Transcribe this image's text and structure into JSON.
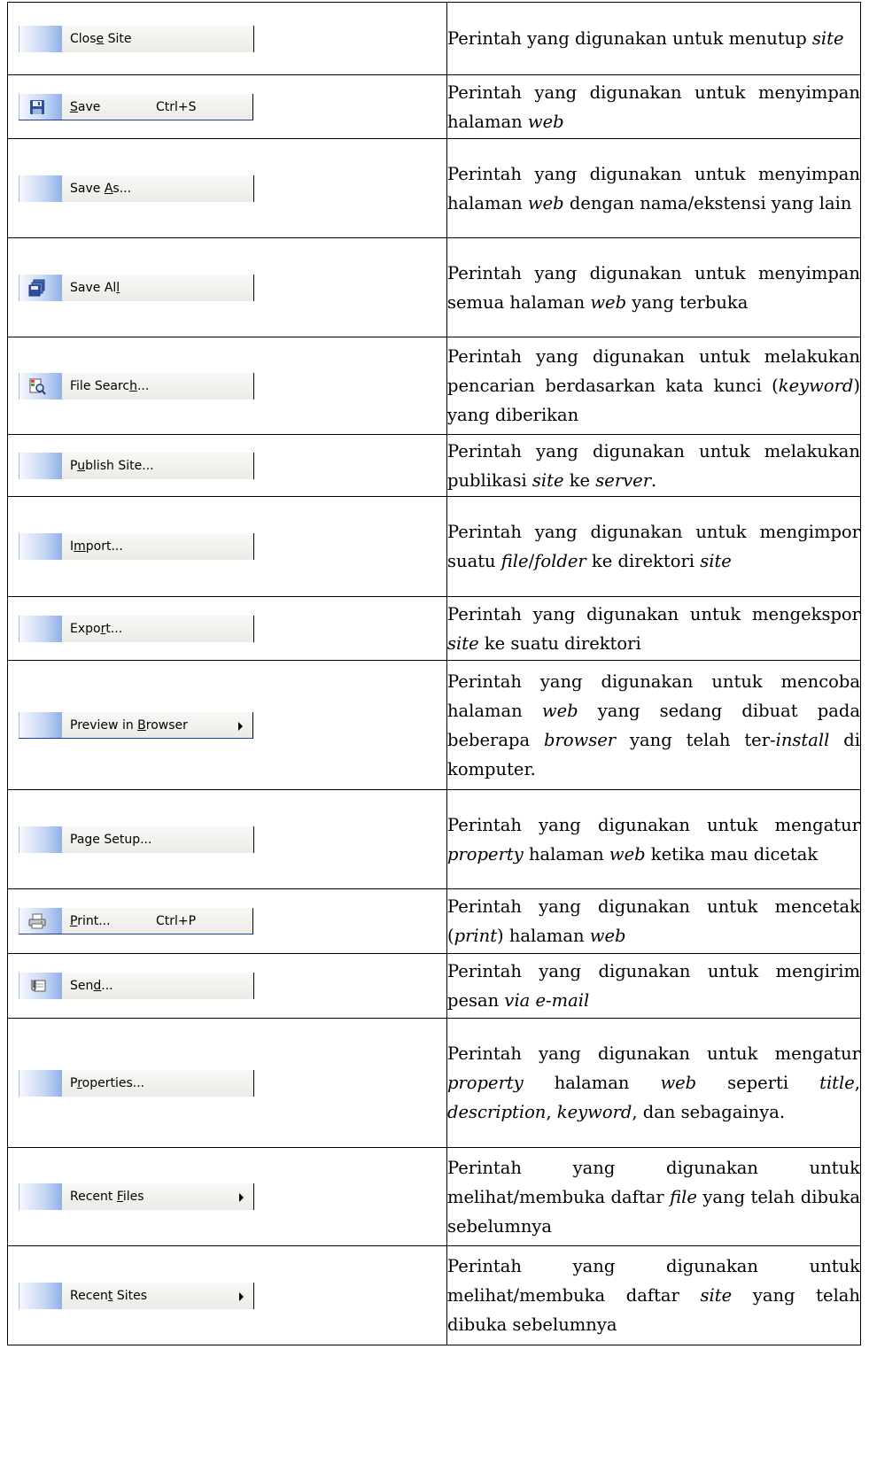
{
  "rows": [
    {
      "menu": {
        "pre": "Clos",
        "acc": "e",
        "post": " Site"
      },
      "desc": [
        "Perintah yang digunakan untuk menutup ",
        {
          "i": "site"
        }
      ]
    },
    {
      "menu": {
        "pre": "",
        "acc": "S",
        "post": "ave"
      },
      "shortcut": "Ctrl+S",
      "icon": "floppy-disk-icon",
      "selected": true,
      "desc": [
        "Perintah yang digunakan untuk menyimpan halaman ",
        {
          "i": "web"
        }
      ]
    },
    {
      "menu": {
        "pre": "Save ",
        "acc": "A",
        "post": "s..."
      },
      "desc": [
        "Perintah yang digunakan untuk menyimpan halaman ",
        {
          "i": "web"
        },
        " dengan nama/ekstensi yang lain"
      ]
    },
    {
      "menu": {
        "pre": "Save Al",
        "acc": "l",
        "post": ""
      },
      "icon": "save-all-icon",
      "desc": [
        "Perintah yang digunakan untuk menyimpan semua halaman ",
        {
          "i": "web"
        },
        " yang terbuka"
      ]
    },
    {
      "menu": {
        "pre": "File Searc",
        "acc": "h",
        "post": "..."
      },
      "icon": "file-search-icon",
      "desc": [
        "Perintah yang digunakan untuk melakukan pencarian berdasarkan kata kunci (",
        {
          "i": "keyword"
        },
        ") yang diberikan"
      ]
    },
    {
      "menu": {
        "pre": "P",
        "acc": "u",
        "post": "blish Site..."
      },
      "desc": [
        "Perintah yang digunakan untuk melakukan publikasi ",
        {
          "i": "site"
        },
        " ke ",
        {
          "i": "server"
        },
        "."
      ]
    },
    {
      "menu": {
        "pre": "I",
        "acc": "m",
        "post": "port..."
      },
      "desc": [
        "Perintah yang digunakan untuk mengimpor suatu ",
        {
          "i": "file"
        },
        "/",
        {
          "i": "folder"
        },
        " ke direktori ",
        {
          "i": "site"
        }
      ]
    },
    {
      "menu": {
        "pre": "Expo",
        "acc": "r",
        "post": "t..."
      },
      "desc": [
        "Perintah yang digunakan untuk mengekspor ",
        {
          "i": "site"
        },
        " ke suatu direktori"
      ]
    },
    {
      "menu": {
        "pre": "Preview in ",
        "acc": "B",
        "post": "rowser"
      },
      "arrow": true,
      "selected": true,
      "desc": [
        "Perintah yang digunakan untuk mencoba halaman ",
        {
          "i": "web"
        },
        " yang sedang dibuat pada beberapa ",
        {
          "i": "browser"
        },
        " yang telah ter-",
        {
          "i": "install"
        },
        " di komputer."
      ]
    },
    {
      "menu": {
        "pre": "Pa",
        "acc": "g",
        "post": "e Setup..."
      },
      "desc": [
        "Perintah yang digunakan untuk mengatur ",
        {
          "i": "property"
        },
        " halaman ",
        {
          "i": "web"
        },
        " ketika mau dicetak"
      ]
    },
    {
      "menu": {
        "pre": "",
        "acc": "P",
        "post": "rint..."
      },
      "shortcut": "Ctrl+P",
      "icon": "printer-icon",
      "selected": true,
      "desc": [
        "Perintah yang digunakan untuk mencetak (",
        {
          "i": "print"
        },
        ") halaman ",
        {
          "i": "web"
        }
      ]
    },
    {
      "menu": {
        "pre": "Sen",
        "acc": "d",
        "post": "..."
      },
      "icon": "send-mail-icon",
      "desc": [
        "Perintah yang digunakan untuk mengirim pesan ",
        {
          "i": "via e-mail"
        }
      ]
    },
    {
      "menu": {
        "pre": "P",
        "acc": "r",
        "post": "operties..."
      },
      "desc": [
        "Perintah yang digunakan untuk mengatur ",
        {
          "i": "property"
        },
        " halaman ",
        {
          "i": "web"
        },
        " seperti ",
        {
          "i": "title"
        },
        ", ",
        {
          "i": "description"
        },
        ", ",
        {
          "i": "keyword"
        },
        ", dan sebagainya."
      ]
    },
    {
      "menu": {
        "pre": "Recent ",
        "acc": "F",
        "post": "iles"
      },
      "arrow": true,
      "desc": [
        "Perintah yang digunakan untuk melihat/membuka daftar ",
        {
          "i": "file"
        },
        " yang telah dibuka sebelumnya"
      ]
    },
    {
      "menu": {
        "pre": "Recen",
        "acc": "t",
        "post": " Sites"
      },
      "arrow": true,
      "desc": [
        "Perintah yang digunakan untuk melihat/membuka daftar ",
        {
          "i": "site"
        },
        " yang telah dibuka sebelumnya"
      ]
    }
  ]
}
